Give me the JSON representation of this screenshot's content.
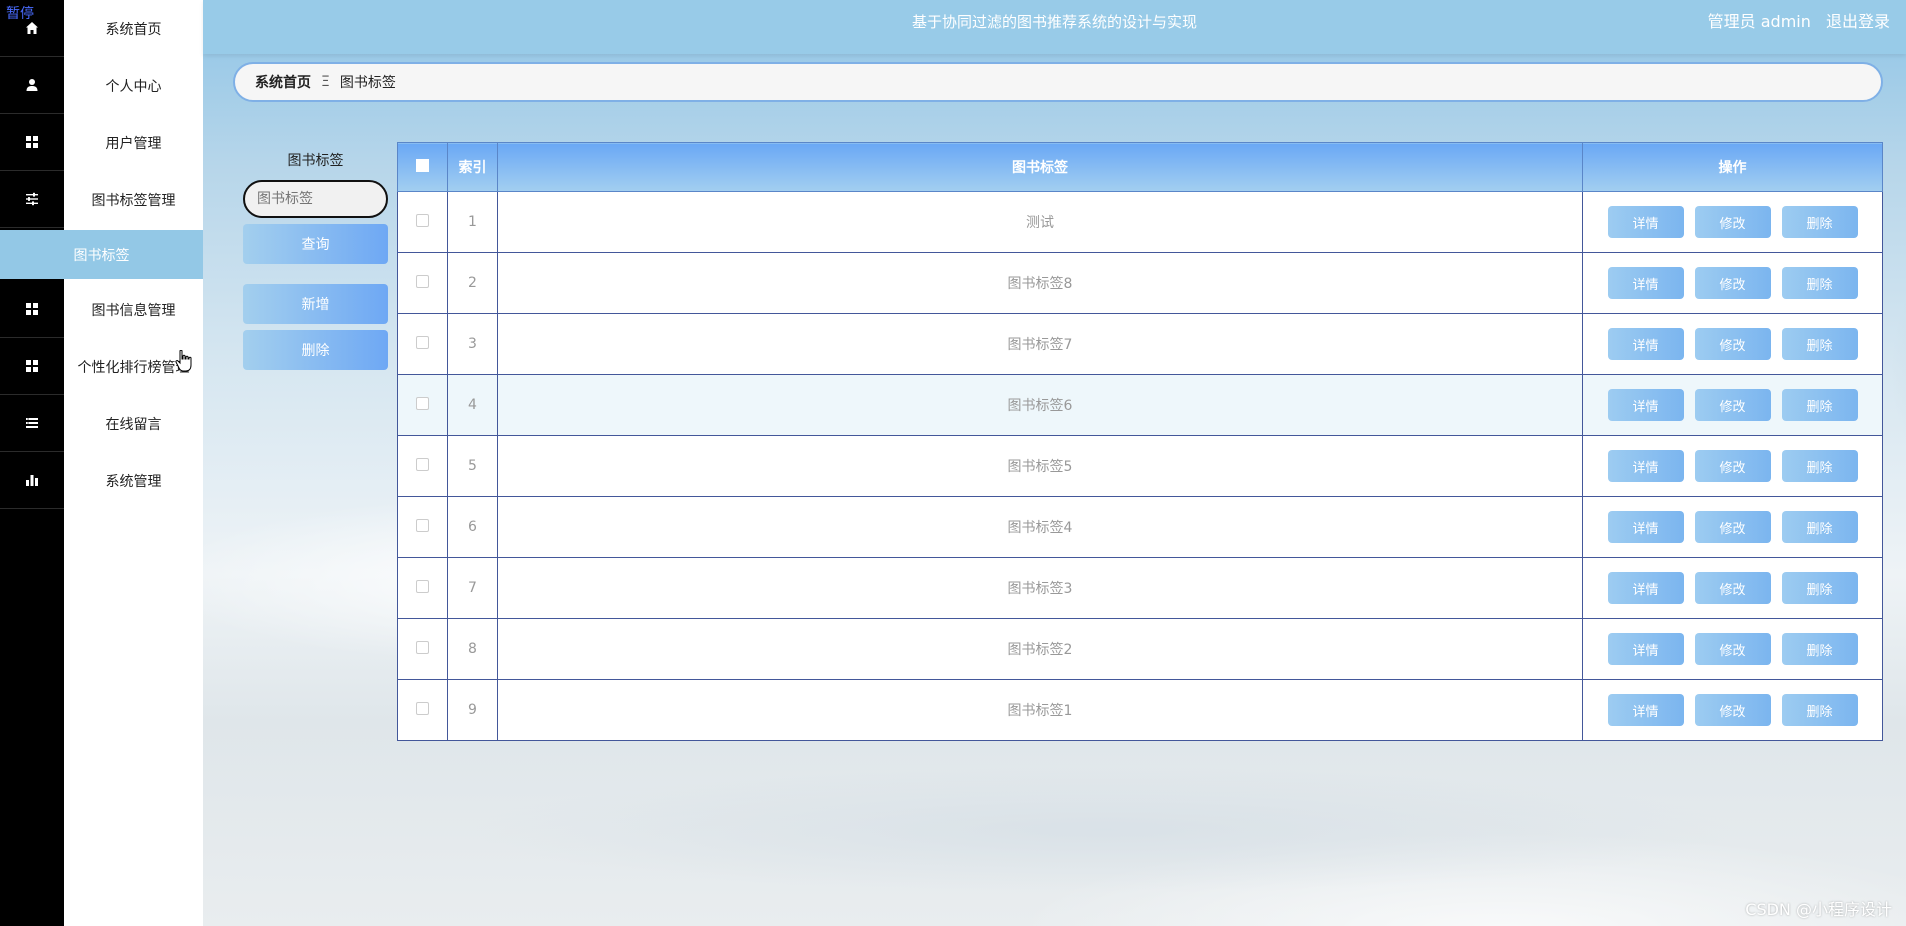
{
  "header": {
    "title": "基于协同过滤的图书推荐系统的设计与实现",
    "user": "管理员 admin",
    "logout": "退出登录",
    "color": "#98cbe8"
  },
  "overlay": {
    "pause_label": "暂停"
  },
  "rail": {
    "icons": [
      "home-icon",
      "user-icon",
      "grid-icon",
      "sliders-icon",
      "grid-icon",
      "grid-icon",
      "list-icon",
      "bar-chart-icon"
    ]
  },
  "menu": {
    "items": [
      {
        "label": "系统首页"
      },
      {
        "label": "个人中心"
      },
      {
        "label": "用户管理"
      },
      {
        "label": "图书标签管理"
      },
      {
        "label": "图书信息管理"
      },
      {
        "label": "个性化排行榜管理"
      },
      {
        "label": "在线留言"
      },
      {
        "label": "系统管理"
      }
    ],
    "active_sub": "图书标签"
  },
  "breadcrumb": {
    "home": "系统首页",
    "separator": "Ξ",
    "current": "图书标签"
  },
  "search": {
    "label": "图书标签",
    "placeholder": "图书标签",
    "query_button": "查询",
    "add_button": "新增",
    "delete_button": "删除"
  },
  "table": {
    "columns": {
      "index": "索引",
      "tag": "图书标签",
      "ops": "操作"
    },
    "op_labels": {
      "detail": "详情",
      "edit": "修改",
      "delete": "删除"
    },
    "rows": [
      {
        "index": "1",
        "tag": "测试"
      },
      {
        "index": "2",
        "tag": "图书标签8"
      },
      {
        "index": "3",
        "tag": "图书标签7"
      },
      {
        "index": "4",
        "tag": "图书标签6"
      },
      {
        "index": "5",
        "tag": "图书标签5"
      },
      {
        "index": "6",
        "tag": "图书标签4"
      },
      {
        "index": "7",
        "tag": "图书标签3"
      },
      {
        "index": "8",
        "tag": "图书标签2"
      },
      {
        "index": "9",
        "tag": "图书标签1"
      }
    ],
    "highlighted_row": "4"
  },
  "watermark": "CSDN @小程序设计"
}
